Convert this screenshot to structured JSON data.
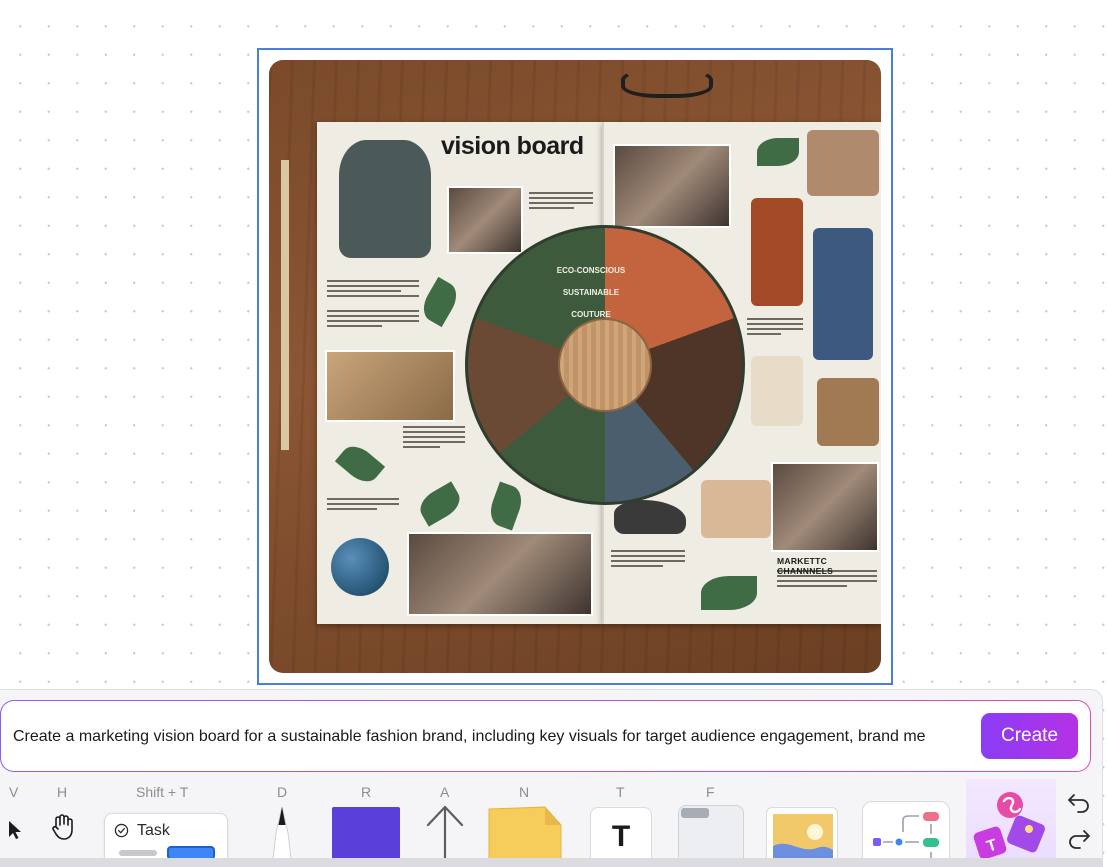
{
  "canvas": {
    "image": {
      "board_title": "vision board",
      "wheel_segments": [
        "ECO-CONSCIOUS",
        "SUSTAINABLE",
        "COUTURE"
      ],
      "marketing_label": "MARKETTC CHANNNELS"
    }
  },
  "prompt": {
    "value": "Create a marketing vision board for a sustainable fashion brand, including key visuals for target audience engagement, brand me",
    "create_label": "Create"
  },
  "toolbar": {
    "shortcuts": {
      "select": "V",
      "hand": "H",
      "task": "Shift + T",
      "pen": "D",
      "rectangle": "R",
      "arrow": "A",
      "sticky": "N",
      "text": "T",
      "frame": "F"
    },
    "task_label": "Task",
    "text_tool_glyph": "T"
  },
  "colors": {
    "accent_purple": "#8a3cf5",
    "selection_blue": "#4a7fe0",
    "rectangle_tool": "#5a3fd8",
    "task_blue": "#3d86f5"
  }
}
